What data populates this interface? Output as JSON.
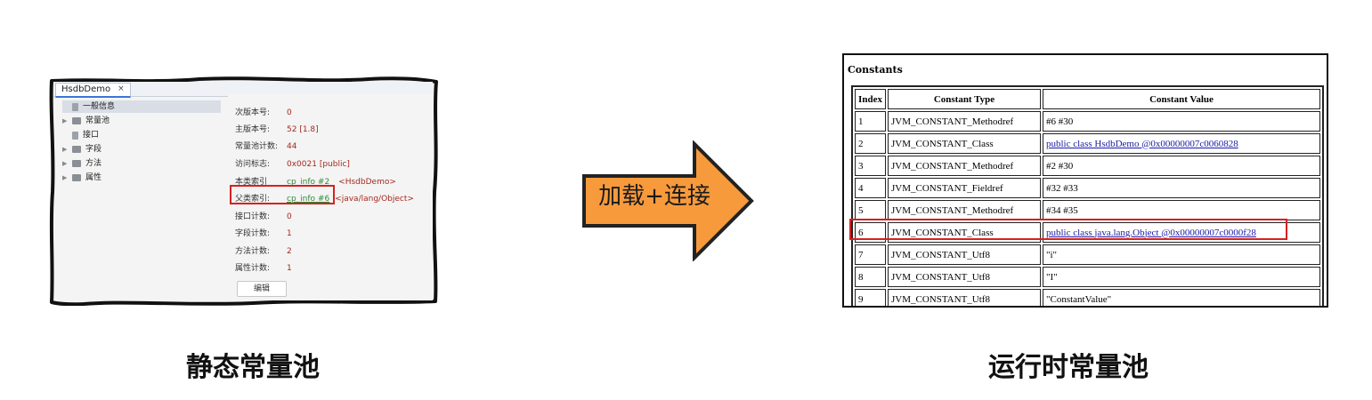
{
  "left": {
    "tab_title": "HsdbDemo",
    "tab_close": "×",
    "tree": [
      {
        "label": "一般信息",
        "selected": true,
        "icon": "file-icon"
      },
      {
        "label": "常量池",
        "icon": "folder-icon"
      },
      {
        "label": "接口",
        "icon": "file-icon"
      },
      {
        "label": "字段",
        "icon": "folder-icon"
      },
      {
        "label": "方法",
        "icon": "folder-icon"
      },
      {
        "label": "属性",
        "icon": "folder-icon"
      }
    ],
    "props": [
      {
        "label": "次版本号:",
        "value": "0"
      },
      {
        "label": "主版本号:",
        "value": "52 [1.8]"
      },
      {
        "label": "常量池计数:",
        "value": "44"
      },
      {
        "label": "访问标志:",
        "value": "0x0021 [public]"
      },
      {
        "label": "本类索引",
        "value": "cp_info #2",
        "extra": "<HsdbDemo>"
      },
      {
        "label": "父类索引:",
        "value": "cp_info #6",
        "extra": "<java/lang/Object>"
      },
      {
        "label": "接口计数:",
        "value": "0"
      },
      {
        "label": "字段计数:",
        "value": "1"
      },
      {
        "label": "方法计数:",
        "value": "2"
      },
      {
        "label": "属性计数:",
        "value": "1"
      }
    ],
    "edit_button": "编辑",
    "caption": "静态常量池"
  },
  "arrow": {
    "label": "加载+连接",
    "color": "#f79a3c"
  },
  "right": {
    "title": "Constants",
    "headers": [
      "Index",
      "Constant Type",
      "Constant Value"
    ],
    "rows": [
      {
        "index": "1",
        "type": "JVM_CONSTANT_Methodref",
        "value": "#6 #30"
      },
      {
        "index": "2",
        "type": "JVM_CONSTANT_Class",
        "value": "public class HsdbDemo @0x00000007c0060828",
        "link": true
      },
      {
        "index": "3",
        "type": "JVM_CONSTANT_Methodref",
        "value": "#2 #30"
      },
      {
        "index": "4",
        "type": "JVM_CONSTANT_Fieldref",
        "value": "#32 #33"
      },
      {
        "index": "5",
        "type": "JVM_CONSTANT_Methodref",
        "value": "#34 #35"
      },
      {
        "index": "6",
        "type": "JVM_CONSTANT_Class",
        "value": "public class java.lang.Object @0x00000007c0000f28",
        "link": true
      },
      {
        "index": "7",
        "type": "JVM_CONSTANT_Utf8",
        "value": "\"i\""
      },
      {
        "index": "8",
        "type": "JVM_CONSTANT_Utf8",
        "value": "\"I\""
      },
      {
        "index": "9",
        "type": "JVM_CONSTANT_Utf8",
        "value": "\"ConstantValue\""
      }
    ],
    "caption": "运行时常量池"
  },
  "colors": {
    "highlight": "#d82020",
    "link": "#1b1ba8",
    "value": "#a32a1f",
    "cp_link": "#2e8b3a"
  }
}
